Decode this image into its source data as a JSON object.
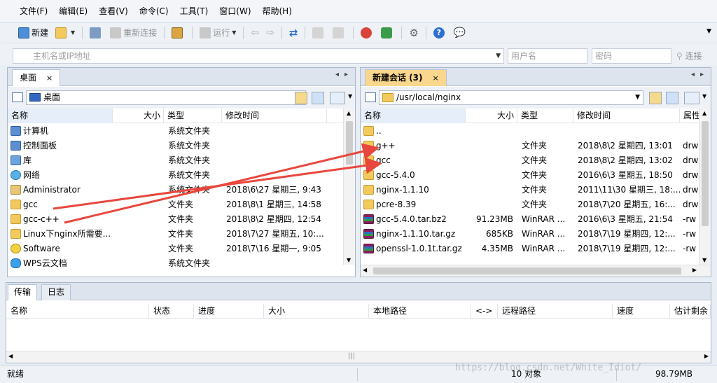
{
  "menu": [
    "文件(F)",
    "编辑(E)",
    "查看(V)",
    "命令(C)",
    "工具(T)",
    "窗口(W)",
    "帮助(H)"
  ],
  "toolbar": {
    "new_label": "新建",
    "reconnect_label": "重新连接",
    "run_label": "运行"
  },
  "address": {
    "host_placeholder": "主机名或IP地址",
    "user_placeholder": "用户名",
    "password_placeholder": "密码",
    "connect_label": "连接"
  },
  "left_pane": {
    "tab": "桌面",
    "tab_close": "×",
    "path": "桌面",
    "columns": [
      "名称",
      "大小",
      "类型",
      "修改时间"
    ],
    "rows": [
      {
        "icon": "computer-icon",
        "name": "计算机",
        "size": "",
        "type": "系统文件夹",
        "mtime": ""
      },
      {
        "icon": "control-panel-icon",
        "name": "控制面板",
        "size": "",
        "type": "系统文件夹",
        "mtime": ""
      },
      {
        "icon": "library-icon",
        "name": "库",
        "size": "",
        "type": "系统文件夹",
        "mtime": ""
      },
      {
        "icon": "network-icon",
        "name": "网络",
        "size": "",
        "type": "系统文件夹",
        "mtime": ""
      },
      {
        "icon": "user-folder-icon",
        "name": "Administrator",
        "size": "",
        "type": "系统文件夹",
        "mtime": "2018\\6\\27 星期三, 9:43"
      },
      {
        "icon": "folder-icon",
        "name": "gcc",
        "size": "",
        "type": "文件夹",
        "mtime": "2018\\8\\1 星期三, 14:58"
      },
      {
        "icon": "folder-icon",
        "name": "gcc-c++",
        "size": "",
        "type": "文件夹",
        "mtime": "2018\\8\\2 星期四, 12:54"
      },
      {
        "icon": "folder-icon",
        "name": "Linux下nginx所需要...",
        "size": "",
        "type": "文件夹",
        "mtime": "2018\\7\\27 星期五, 10:..."
      },
      {
        "icon": "software-icon",
        "name": "Software",
        "size": "",
        "type": "文件夹",
        "mtime": "2018\\7\\16 星期一, 9:05"
      },
      {
        "icon": "wps-cloud-icon",
        "name": "WPS云文档",
        "size": "",
        "type": "系统文件夹",
        "mtime": ""
      }
    ]
  },
  "right_pane": {
    "tab": "新建会话 (3)",
    "tab_close": "×",
    "path": "/usr/local/nginx",
    "columns": [
      "名称",
      "大小",
      "类型",
      "修改时间",
      "属性"
    ],
    "rows": [
      {
        "icon": "up-folder-icon",
        "name": "..",
        "size": "",
        "type": "",
        "mtime": "",
        "attr": ""
      },
      {
        "icon": "folder-icon",
        "name": "g++",
        "size": "",
        "type": "文件夹",
        "mtime": "2018\\8\\2 星期四, 13:01",
        "attr": "drw"
      },
      {
        "icon": "folder-icon",
        "name": "gcc",
        "size": "",
        "type": "文件夹",
        "mtime": "2018\\8\\2 星期四, 13:02",
        "attr": "drw"
      },
      {
        "icon": "folder-icon",
        "name": "gcc-5.4.0",
        "size": "",
        "type": "文件夹",
        "mtime": "2016\\6\\3 星期五, 18:50",
        "attr": "drw"
      },
      {
        "icon": "folder-icon",
        "name": "nginx-1.1.10",
        "size": "",
        "type": "文件夹",
        "mtime": "2011\\11\\30 星期三, 18:...",
        "attr": "drw"
      },
      {
        "icon": "folder-icon",
        "name": "pcre-8.39",
        "size": "",
        "type": "文件夹",
        "mtime": "2018\\7\\20 星期五, 16:...",
        "attr": "drw"
      },
      {
        "icon": "winrar-icon",
        "name": "gcc-5.4.0.tar.bz2",
        "size": "91.23MB",
        "type": "WinRAR ...",
        "mtime": "2016\\6\\3 星期五, 21:54",
        "attr": "-rw"
      },
      {
        "icon": "winrar-icon",
        "name": "nginx-1.1.10.tar.gz",
        "size": "685KB",
        "type": "WinRAR ...",
        "mtime": "2018\\7\\19 星期四, 12:...",
        "attr": "-rw"
      },
      {
        "icon": "winrar-icon",
        "name": "openssl-1.0.1t.tar.gz",
        "size": "4.35MB",
        "type": "WinRAR ...",
        "mtime": "2018\\7\\19 星期四, 12:...",
        "attr": "-rw"
      }
    ]
  },
  "transfer": {
    "tabs": [
      "传输",
      "日志"
    ],
    "columns": [
      "名称",
      "状态",
      "进度",
      "大小",
      "本地路径",
      "<->",
      "远程路径",
      "速度",
      "估计剩余"
    ]
  },
  "status": {
    "ready": "就绪",
    "objects": "10 对象",
    "total_size": "98.79MB"
  },
  "watermark": "https://blog.csdn.net/White_Idiot/",
  "colors": {
    "accent_tab": "#fbd78e",
    "arrow": "#e8473d",
    "folder": "#f2c95c"
  }
}
